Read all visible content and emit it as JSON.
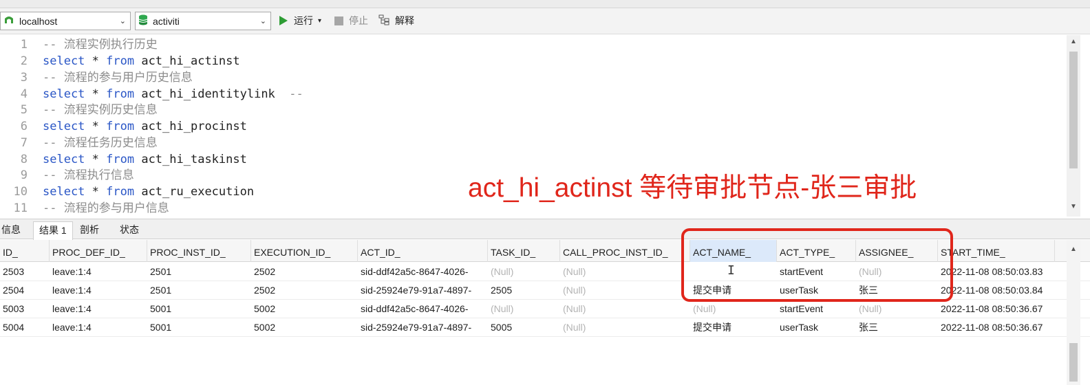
{
  "toolbar": {
    "connection": "localhost",
    "database": "activiti",
    "run_label": "运行",
    "run_dropdown": "▾",
    "stop_label": "停止",
    "explain_label": "解释"
  },
  "editor": {
    "lines": [
      {
        "n": "1",
        "comment": "-- 流程实例执行历史"
      },
      {
        "n": "2",
        "kw1": "select",
        "mid": " * ",
        "kw2": "from",
        "rest": " act_hi_actinst"
      },
      {
        "n": "3",
        "comment": "-- 流程的参与用户历史信息"
      },
      {
        "n": "4",
        "kw1": "select",
        "mid": " * ",
        "kw2": "from",
        "rest": " act_hi_identitylink  ",
        "trail": "--"
      },
      {
        "n": "5",
        "comment": "-- 流程实例历史信息"
      },
      {
        "n": "6",
        "kw1": "select",
        "mid": " * ",
        "kw2": "from",
        "rest": " act_hi_procinst"
      },
      {
        "n": "7",
        "comment": "-- 流程任务历史信息"
      },
      {
        "n": "8",
        "kw1": "select",
        "mid": " * ",
        "kw2": "from",
        "rest": " act_hi_taskinst"
      },
      {
        "n": "9",
        "comment": "-- 流程执行信息"
      },
      {
        "n": "10",
        "kw1": "select",
        "mid": " * ",
        "kw2": "from",
        "rest": " act_ru_execution"
      },
      {
        "n": "11",
        "comment": "-- 流程的参与用户信息"
      }
    ]
  },
  "annotation": "act_hi_actinst 等待审批节点-张三审批",
  "tabs": [
    "信息",
    "结果 1",
    "剖析",
    "状态"
  ],
  "grid": {
    "columns": [
      "ID_",
      "PROC_DEF_ID_",
      "PROC_INST_ID_",
      "EXECUTION_ID_",
      "ACT_ID_",
      "TASK_ID_",
      "CALL_PROC_INST_ID_",
      "ACT_NAME_",
      "ACT_TYPE_",
      "ASSIGNEE_",
      "START_TIME_"
    ],
    "rows": [
      [
        "2503",
        "leave:1:4",
        "2501",
        "2502",
        "sid-ddf42a5c-8647-4026-",
        "(Null)",
        "(Null)",
        "",
        "startEvent",
        "(Null)",
        "2022-11-08 08:50:03.83"
      ],
      [
        "2504",
        "leave:1:4",
        "2501",
        "2502",
        "sid-25924e79-91a7-4897-",
        "2505",
        "(Null)",
        "提交申请",
        "userTask",
        "张三",
        "2022-11-08 08:50:03.84"
      ],
      [
        "5003",
        "leave:1:4",
        "5001",
        "5002",
        "sid-ddf42a5c-8647-4026-",
        "(Null)",
        "(Null)",
        "(Null)",
        "startEvent",
        "(Null)",
        "2022-11-08 08:50:36.67"
      ],
      [
        "5004",
        "leave:1:4",
        "5001",
        "5002",
        "sid-25924e79-91a7-4897-",
        "5005",
        "(Null)",
        "提交申请",
        "userTask",
        "张三",
        "2022-11-08 08:50:36.67"
      ]
    ]
  },
  "colors": {
    "annotation": "#e0261b",
    "keyword": "#2a56c6",
    "comment": "#8c8c8c",
    "null_text": "#b3b3b3"
  }
}
